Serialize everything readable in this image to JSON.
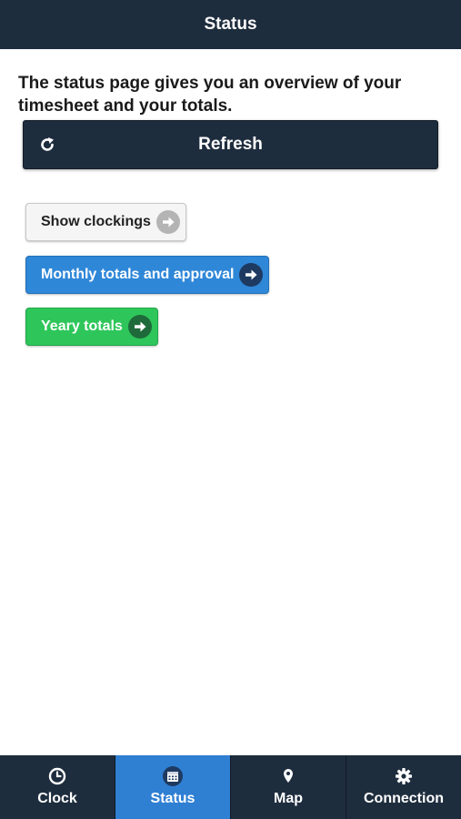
{
  "header": {
    "title": "Status"
  },
  "intro": {
    "text": "The status page gives you an overview of your timesheet and your totals."
  },
  "refresh": {
    "label": "Refresh",
    "icon": "refresh-icon"
  },
  "buttons": [
    {
      "label": "Show clockings",
      "icon": "arrow-right-icon",
      "color": "#f5f5f5"
    },
    {
      "label": "Monthly totals and approval",
      "icon": "arrow-right-icon",
      "color": "#2f87d8"
    },
    {
      "label": "Yeary totals",
      "icon": "arrow-right-icon",
      "color": "#2ec65a"
    }
  ],
  "tabbar": {
    "active": "Status",
    "accent": "#2f7fd3",
    "tabs": [
      {
        "label": "Clock",
        "icon": "clock-icon"
      },
      {
        "label": "Status",
        "icon": "calendar-icon"
      },
      {
        "label": "Map",
        "icon": "map-pin-icon"
      },
      {
        "label": "Connection",
        "icon": "gear-icon"
      }
    ]
  }
}
